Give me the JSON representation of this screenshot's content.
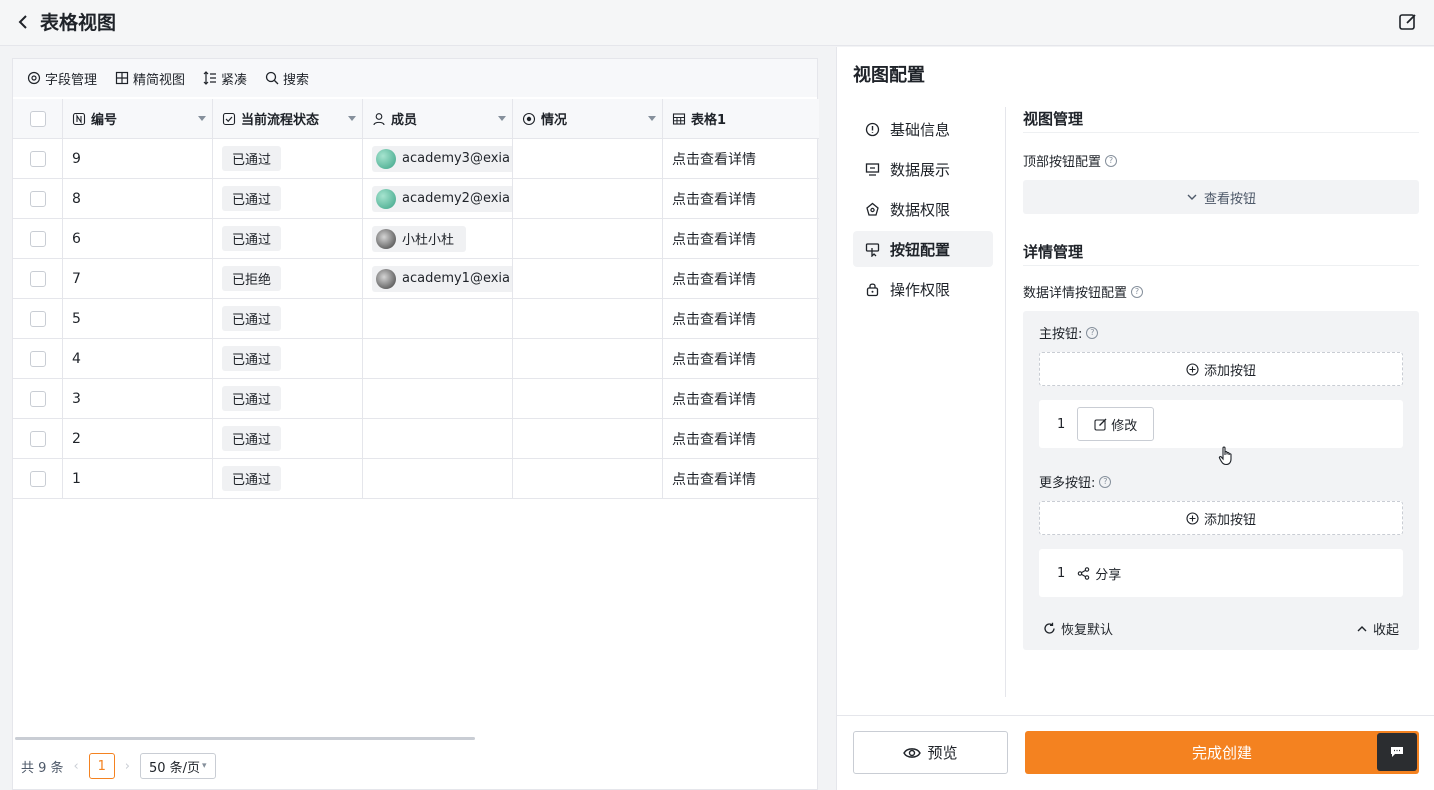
{
  "header": {
    "title": "表格视图",
    "back_icon": "chevron-left-icon",
    "edit_icon": "edit-icon"
  },
  "toolbar": {
    "items": [
      "字段管理",
      "精简视图",
      "紧凑",
      "搜索"
    ]
  },
  "table": {
    "columns": [
      "编号",
      "当前流程状态",
      "成员",
      "情况",
      "表格1"
    ],
    "rows": [
      {
        "id": "9",
        "status": "已通过",
        "member": "academy3@exia",
        "detail": "点击查看详情"
      },
      {
        "id": "8",
        "status": "已通过",
        "member": "academy2@exia",
        "detail": "点击查看详情"
      },
      {
        "id": "6",
        "status": "已通过",
        "member": "小杜小杜",
        "detail": "点击查看详情"
      },
      {
        "id": "7",
        "status": "已拒绝",
        "member": "academy1@exia",
        "detail": "点击查看详情"
      },
      {
        "id": "5",
        "status": "已通过",
        "member": "",
        "detail": "点击查看详情"
      },
      {
        "id": "4",
        "status": "已通过",
        "member": "",
        "detail": "点击查看详情"
      },
      {
        "id": "3",
        "status": "已通过",
        "member": "",
        "detail": "点击查看详情"
      },
      {
        "id": "2",
        "status": "已通过",
        "member": "",
        "detail": "点击查看详情"
      },
      {
        "id": "1",
        "status": "已通过",
        "member": "",
        "detail": "点击查看详情"
      }
    ]
  },
  "pager": {
    "total": "共 9 条",
    "page": "1",
    "size": "50 条/页"
  },
  "config": {
    "title": "视图配置",
    "menu": [
      "基础信息",
      "数据展示",
      "数据权限",
      "按钮配置",
      "操作权限"
    ],
    "active_menu": "按钮配置",
    "view_mgmt": {
      "title": "视图管理",
      "top_btn_label": "顶部按钮配置",
      "view_btn": "查看按钮"
    },
    "detail_mgmt": {
      "title": "详情管理",
      "detail_btn_label": "数据详情按钮配置",
      "main_label": "主按钮:",
      "add_btn": "添加按钮",
      "main_index": "1",
      "modify": "修改",
      "more_label": "更多按钮:",
      "more_index": "1",
      "share": "分享",
      "restore": "恢复默认",
      "collapse": "收起"
    },
    "preview": "预览",
    "create": "完成创建"
  },
  "colors": {
    "accent": "#f48220"
  }
}
